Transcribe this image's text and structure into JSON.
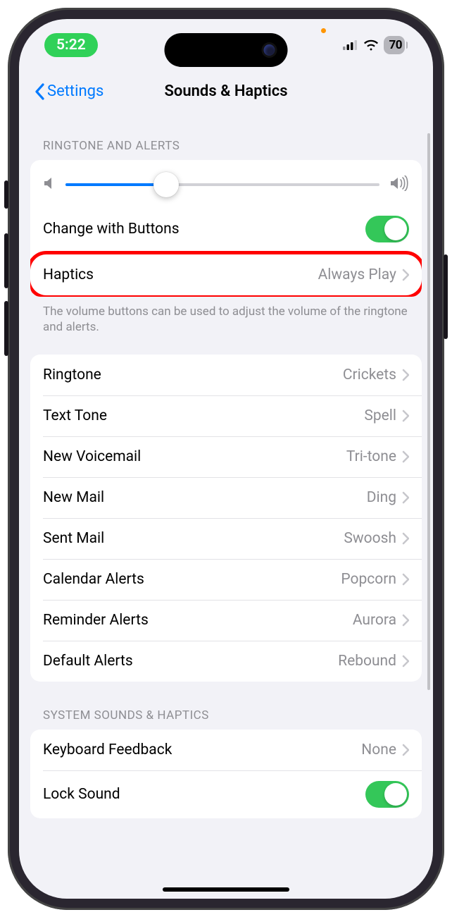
{
  "status": {
    "time": "5:22",
    "battery": "70"
  },
  "nav": {
    "back": "Settings",
    "title": "Sounds & Haptics"
  },
  "sections": {
    "ringtone_header": "RINGTONE AND ALERTS",
    "system_header": "SYSTEM SOUNDS & HAPTICS"
  },
  "slider": {
    "value_percent": 32
  },
  "rows": {
    "change_buttons": {
      "label": "Change with Buttons",
      "on": true
    },
    "haptics": {
      "label": "Haptics",
      "value": "Always Play"
    },
    "footer_note": "The volume buttons can be used to adjust the volume of the ringtone and alerts.",
    "ringtone": {
      "label": "Ringtone",
      "value": "Crickets"
    },
    "text_tone": {
      "label": "Text Tone",
      "value": "Spell"
    },
    "new_voicemail": {
      "label": "New Voicemail",
      "value": "Tri-tone"
    },
    "new_mail": {
      "label": "New Mail",
      "value": "Ding"
    },
    "sent_mail": {
      "label": "Sent Mail",
      "value": "Swoosh"
    },
    "calendar_alerts": {
      "label": "Calendar Alerts",
      "value": "Popcorn"
    },
    "reminder_alerts": {
      "label": "Reminder Alerts",
      "value": "Aurora"
    },
    "default_alerts": {
      "label": "Default Alerts",
      "value": "Rebound"
    },
    "keyboard_feedback": {
      "label": "Keyboard Feedback",
      "value": "None"
    },
    "lock_sound": {
      "label": "Lock Sound",
      "on": true
    }
  }
}
